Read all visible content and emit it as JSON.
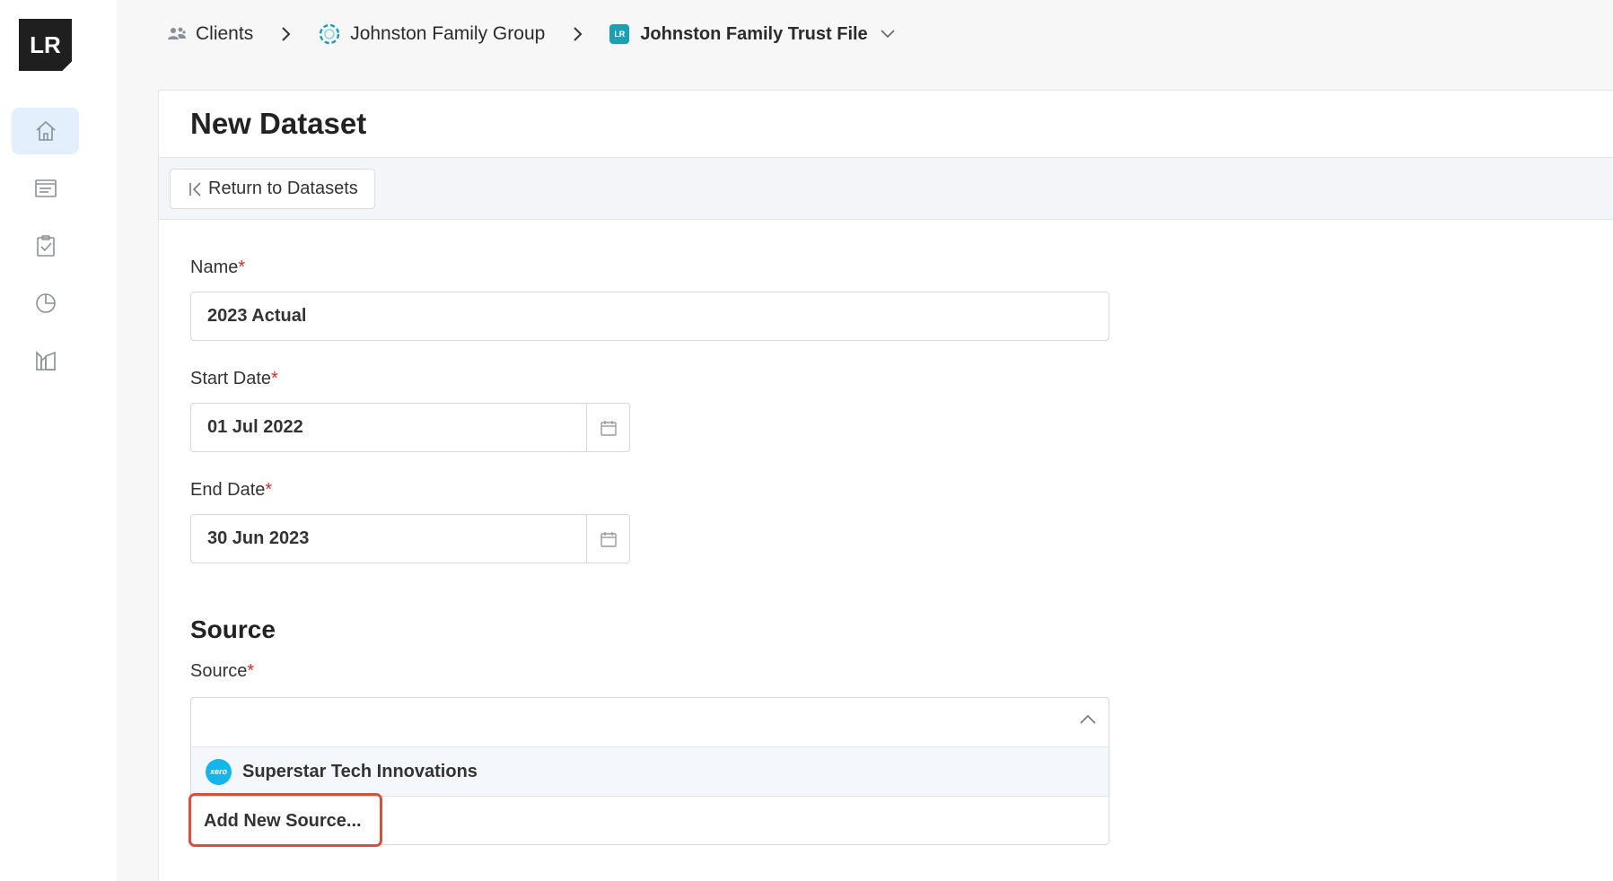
{
  "logo": {
    "text": "LR"
  },
  "sidebar": {
    "items": [
      {
        "icon": "home-icon",
        "active": true
      },
      {
        "icon": "document-list-icon",
        "active": false
      },
      {
        "icon": "clipboard-check-icon",
        "active": false
      },
      {
        "icon": "pie-chart-icon",
        "active": false
      },
      {
        "icon": "building-chart-icon",
        "active": false
      }
    ]
  },
  "breadcrumb": {
    "clients": "Clients",
    "group": "Johnston Family Group",
    "file_badge": "LR",
    "file": "Johnston Family Trust File"
  },
  "page": {
    "title": "New Dataset",
    "return_label": "Return to Datasets"
  },
  "form": {
    "name_label": "Name",
    "name_value": "2023 Actual",
    "start_label": "Start Date",
    "start_value": "01 Jul 2022",
    "end_label": "End Date",
    "end_value": "30 Jun 2023",
    "required_mark": "*"
  },
  "source": {
    "section_title": "Source",
    "label": "Source",
    "option_badge": "xero",
    "option": "Superstar Tech Innovations",
    "add_new": "Add New Source..."
  },
  "colors": {
    "accent": "#e3effc",
    "required": "#d62c2c",
    "highlight": "#d9503a",
    "xero": "#13b5ea",
    "lr_badge": "#1a9fb3"
  }
}
